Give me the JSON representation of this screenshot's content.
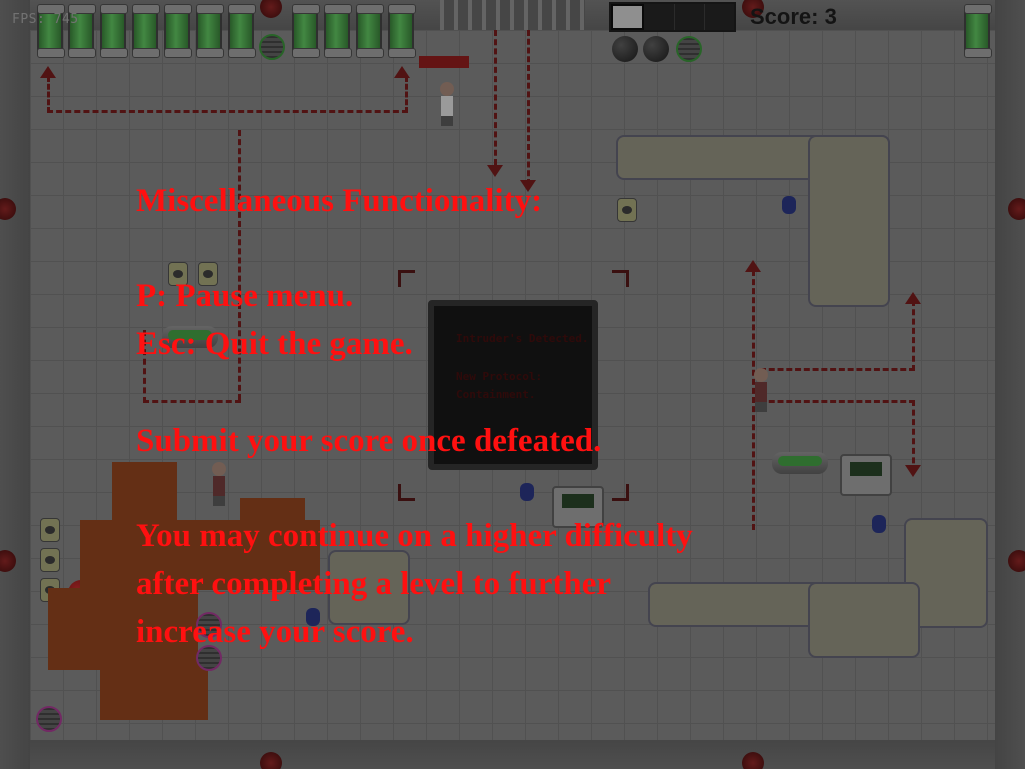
{
  "hud": {
    "fps": "FPS: 745",
    "score_label": "Score:",
    "score_value": "3"
  },
  "monitor": {
    "line1": "Intruder's Detected.",
    "line2": "New Protocol:",
    "line3": "Containment."
  },
  "help": {
    "heading": "Miscellaneous Functionality:",
    "pause": "P: Pause menu.",
    "quit": "Esc: Quit the game.",
    "submit": "Submit your score once defeated.",
    "continue_line1": "You may continue on a higher difficulty",
    "continue_line2": "after completing a level to further",
    "continue_line3": "increase your score."
  },
  "colors": {
    "help_text": "#ff1010",
    "path_dash": "#6e0f0f",
    "canister_green": "#57c157"
  }
}
